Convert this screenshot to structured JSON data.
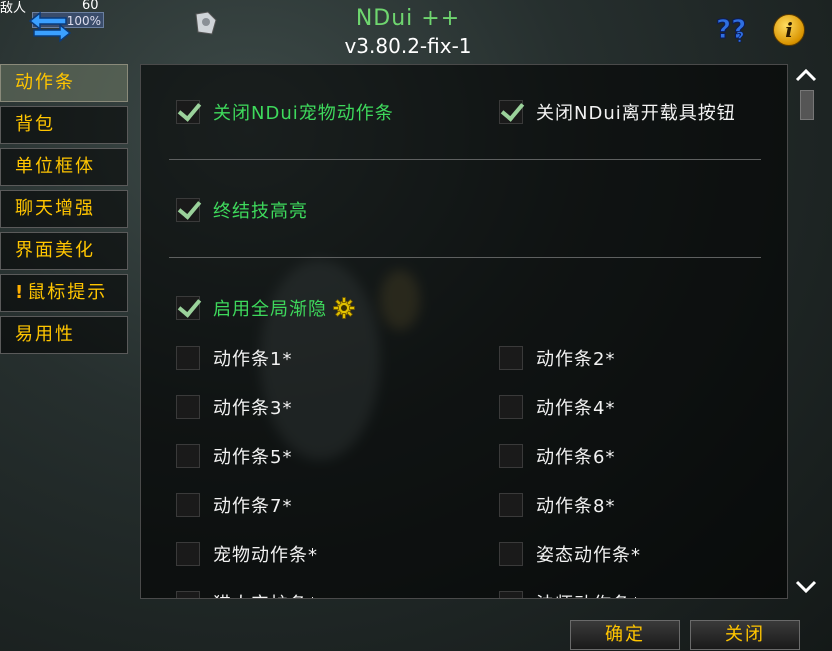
{
  "header": {
    "player_name": "敌人",
    "player_level": "60",
    "health_text": "100%",
    "title": "NDui ++",
    "version": "v3.80.2-fix-1"
  },
  "sidebar": {
    "items": [
      {
        "label": "动作条",
        "active": true
      },
      {
        "label": "背包"
      },
      {
        "label": "单位框体"
      },
      {
        "label": "聊天增强"
      },
      {
        "label": "界面美化"
      },
      {
        "label": "鼠标提示",
        "warn": "!"
      },
      {
        "label": "易用性"
      }
    ]
  },
  "options": {
    "hide_pet_bar": {
      "label": "关闭NDui宠物动作条",
      "checked": true
    },
    "hide_leave_vehicle": {
      "label": "关闭NDui离开载具按钮",
      "checked": true
    },
    "finisher_glow": {
      "label": "终结技高亮",
      "checked": true
    },
    "global_fade": {
      "label": "启用全局渐隐",
      "checked": true
    },
    "bars": [
      {
        "label": "动作条1*",
        "checked": false
      },
      {
        "label": "动作条2*",
        "checked": false
      },
      {
        "label": "动作条3*",
        "checked": false
      },
      {
        "label": "动作条4*",
        "checked": false
      },
      {
        "label": "动作条5*",
        "checked": false
      },
      {
        "label": "动作条6*",
        "checked": false
      },
      {
        "label": "动作条7*",
        "checked": false
      },
      {
        "label": "动作条8*",
        "checked": false
      },
      {
        "label": "宠物动作条*",
        "checked": false
      },
      {
        "label": "姿态动作条*",
        "checked": false
      },
      {
        "label": "猎人守护条*",
        "checked": false
      },
      {
        "label": "法师动作条*",
        "checked": false
      }
    ]
  },
  "footer": {
    "ok_label": "确定",
    "close_label": "关闭"
  },
  "colors": {
    "accent_gold": "#ffc500",
    "label_green": "#3ed95c",
    "title_green": "#6fd66f"
  }
}
